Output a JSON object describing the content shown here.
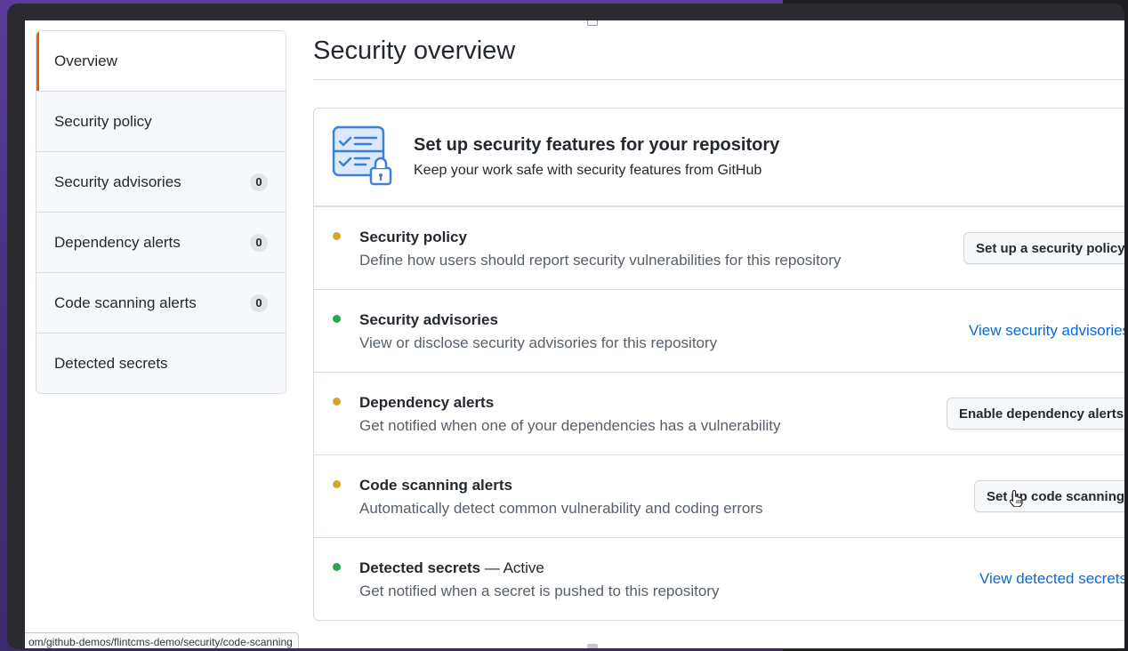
{
  "sidebar": {
    "items": [
      {
        "label": "Overview",
        "count": null,
        "active": true
      },
      {
        "label": "Security policy",
        "count": null
      },
      {
        "label": "Security advisories",
        "count": "0"
      },
      {
        "label": "Dependency alerts",
        "count": "0"
      },
      {
        "label": "Code scanning alerts",
        "count": "0"
      },
      {
        "label": "Detected secrets",
        "count": null
      }
    ]
  },
  "main": {
    "title": "Security overview",
    "hero": {
      "title": "Set up security features for your repository",
      "subtitle": "Keep your work safe with security features from GitHub",
      "icon": "checklist-lock-icon"
    },
    "rows": [
      {
        "title": "Security policy",
        "status_text": "",
        "description": "Define how users should report security vulnerabilities for this repository",
        "status": "warning",
        "action_type": "button",
        "action_label": "Set up a security policy"
      },
      {
        "title": "Security advisories",
        "status_text": "",
        "description": "View or disclose security advisories for this repository",
        "status": "ok",
        "action_type": "link",
        "action_label": "View security advisories"
      },
      {
        "title": "Dependency alerts",
        "status_text": "",
        "description": "Get notified when one of your dependencies has a vulnerability",
        "status": "warning",
        "action_type": "button",
        "action_label": "Enable dependency alerts"
      },
      {
        "title": "Code scanning alerts",
        "status_text": "",
        "description": "Automatically detect common vulnerability and coding errors",
        "status": "warning",
        "action_type": "button",
        "action_label": "Set up code scanning"
      },
      {
        "title": "Detected secrets",
        "status_text": " — Active",
        "description": "Get notified when a secret is pushed to this repository",
        "status": "ok",
        "action_type": "link",
        "action_label": "View detected secrets"
      }
    ]
  },
  "status_bar": {
    "url": "om/github-demos/flintcms-demo/security/code-scanning"
  },
  "colors": {
    "accent_active": "#e36209",
    "status_warning": "#d4a72c",
    "status_ok": "#2da44e",
    "link": "#0969da"
  }
}
